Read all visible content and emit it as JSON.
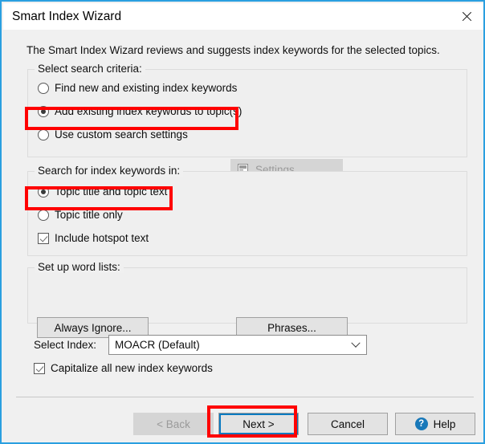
{
  "window": {
    "title": "Smart Index Wizard",
    "close_icon": "close-icon"
  },
  "intro": {
    "text": "The Smart Index Wizard reviews and suggests index keywords for the selected topics."
  },
  "groups": {
    "criteria": {
      "legend": "Select search criteria:",
      "options": [
        {
          "label": "Find new and existing index keywords",
          "checked": false
        },
        {
          "label": "Add existing index keywords to topic(s)",
          "checked": true
        },
        {
          "label": "Use custom search settings",
          "checked": false
        }
      ],
      "settings_button": {
        "label_prefix": "",
        "label_accel": "S",
        "label_rest": "ettings...",
        "icon": "monitor-icon",
        "disabled": true
      }
    },
    "search_in": {
      "legend": "Search for index keywords in:",
      "options": [
        {
          "label": "Topic title and topic text",
          "checked": true
        },
        {
          "label": "Topic title only",
          "checked": false
        }
      ],
      "checkbox": {
        "label": "Include hotspot text",
        "checked": true
      }
    },
    "word_lists": {
      "legend": "Set up word lists:",
      "buttons": [
        {
          "label": "Always Ignore..."
        },
        {
          "label": "Phrases..."
        }
      ]
    }
  },
  "select_index": {
    "label": "Select Index:",
    "value": "MOACR (Default)",
    "arrow_icon": "chevron-down-icon"
  },
  "capitalize": {
    "label": "Capitalize all new index keywords",
    "checked": true
  },
  "footer": {
    "back": {
      "label": "< Back",
      "disabled": true
    },
    "next": {
      "label": "Next >",
      "focused": true
    },
    "cancel": {
      "label": "Cancel"
    },
    "help": {
      "label": "Help",
      "icon": "help-icon",
      "glyph": "?"
    }
  },
  "colors": {
    "window_border": "#2a9fe0",
    "annotation": "#ff0000",
    "focus_border": "#0a7ac0",
    "help_icon": "#1878b9",
    "dialog_bg": "#f0f0f0"
  }
}
